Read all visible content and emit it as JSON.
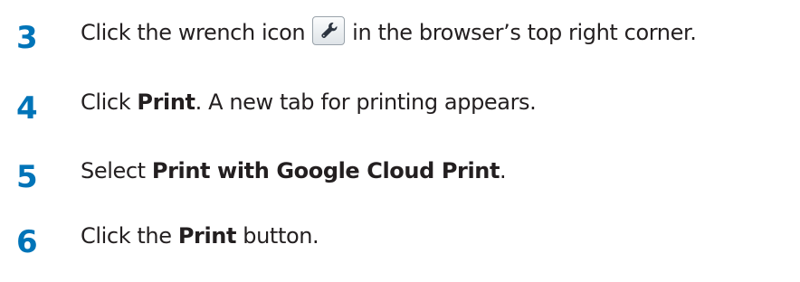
{
  "steps": [
    {
      "number": "3",
      "text_before_icon": "Click the wrench icon",
      "icon": "wrench-icon",
      "text_after_icon": "in the browser’s top right corner."
    },
    {
      "number": "4",
      "text_before_bold": "Click ",
      "bold": "Print",
      "text_after_bold": ". A new tab for printing appears."
    },
    {
      "number": "5",
      "text_before_bold": "Select ",
      "bold": "Print with Google Cloud Print",
      "text_after_bold": "."
    },
    {
      "number": "6",
      "text_before_bold": "Click the ",
      "bold": "Print",
      "text_after_bold": " button."
    }
  ],
  "colors": {
    "step_number": "#0074b8",
    "text": "#231f20"
  }
}
